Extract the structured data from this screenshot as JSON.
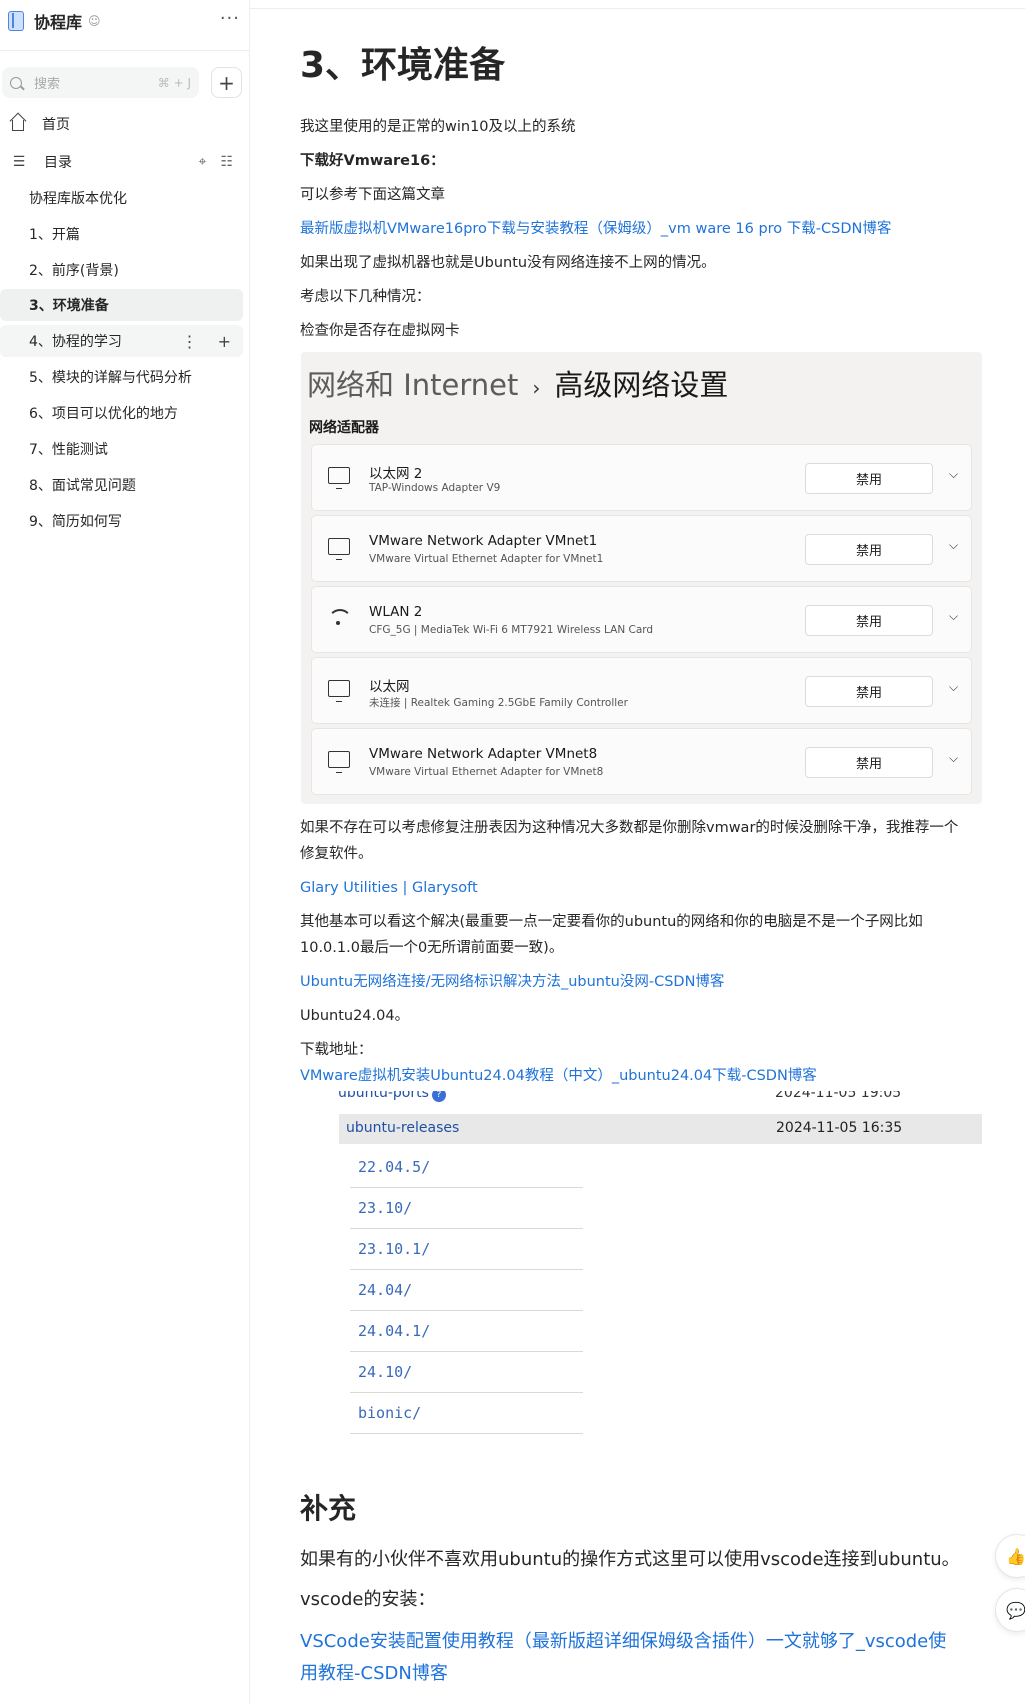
{
  "sidebar": {
    "title": "协程库",
    "more": "···",
    "search_placeholder": "搜索",
    "search_shortcut": "⌘ + J",
    "add": "+",
    "home": "首页",
    "toc": "目录",
    "toc_items": [
      "协程库版本优化",
      "1、开篇",
      "2、前序(背景)",
      "3、环境准备",
      "4、协程的学习",
      "5、模块的详解与代码分析",
      "6、项目可以优化的地方",
      "7、性能测试",
      "8、面试常见问题",
      "9、简历如何写"
    ],
    "active_index": 3,
    "hover_index": 4
  },
  "article": {
    "title": "3、环境准备",
    "p1": "我这里使用的是正常的win10及以上的系统",
    "p2": "下载好Vmware16：",
    "p3": "可以参考下面这篇文章",
    "link1": "最新版虚拟机VMware16pro下载与安装教程（保姆级）_vm ware 16 pro 下载-CSDN博客",
    "p4": "如果出现了虚拟机器也就是Ubuntu没有网络连接不上网的情况。",
    "p5": "考虑以下几种情况：",
    "p6": "检查你是否存在虚拟网卡",
    "p7a": "如果不存在可以考虑修复注册表因为这种情况大多数都是你删除vmwar的时候没删除干净，我推荐一个",
    "p7b": "修复软件。",
    "link2": "Glary Utilities | Glarysoft",
    "p8a": "其他基本可以看这个解决(最重要一点一定要看你的ubuntu的网络和你的电脑是不是一个子网比如",
    "p8b": "10.0.1.0最后一个0无所谓前面要一致)。",
    "link3": "Ubuntu无网络连接/无网络标识解决方法_ubuntu没网-CSDN博客",
    "p9": "Ubuntu24.04。",
    "p10": "下载地址：",
    "link4": "VMware虚拟机安装Ubuntu24.04教程（中文）_ubuntu24.04下载-CSDN博客",
    "h2": "补充",
    "p11": "如果有的小伙伴不喜欢用ubuntu的操作方式这里可以使用vscode连接到ubuntu。",
    "p12": "vscode的安装：",
    "link5a": "VSCode安装配置使用教程（最新版超详细保姆级含插件）一文就够了_vscode使",
    "link5b": "用教程-CSDN博客"
  },
  "network_image": {
    "breadcrumb_parent": "网络和 Internet",
    "breadcrumb_sep": "›",
    "breadcrumb_current": "高级网络设置",
    "section": "网络适配器",
    "adapters": [
      {
        "name": "以太网 2",
        "desc": "TAP-Windows Adapter V9",
        "button": "禁用",
        "icon": "ethernet-icon"
      },
      {
        "name": "VMware Network Adapter VMnet1",
        "desc": "VMware Virtual Ethernet Adapter for VMnet1",
        "button": "禁用",
        "icon": "ethernet-icon"
      },
      {
        "name": "WLAN 2",
        "desc": "CFG_5G | MediaTek Wi-Fi 6 MT7921 Wireless LAN Card",
        "button": "禁用",
        "icon": "wifi-icon"
      },
      {
        "name": "以太网",
        "desc": "未连接 | Realtek Gaming 2.5GbE Family Controller",
        "button": "禁用",
        "icon": "ethernet-icon"
      },
      {
        "name": "VMware Network Adapter VMnet8",
        "desc": "VMware Virtual Ethernet Adapter for VMnet8",
        "button": "禁用",
        "icon": "ethernet-icon"
      }
    ]
  },
  "ubuntu_image": {
    "row1_name": "ubuntu-ports",
    "row1_date": "2024-11-05 19:05",
    "row2_name": "ubuntu-releases",
    "row2_date": "2024-11-05 16:35",
    "versions": [
      "22.04.5/",
      "23.10/",
      "23.10.1/",
      "24.04/",
      "24.04.1/",
      "24.10/",
      "bionic/"
    ]
  },
  "colors": {
    "link": "#1f73d9",
    "active_bg": "#eff0f0"
  }
}
